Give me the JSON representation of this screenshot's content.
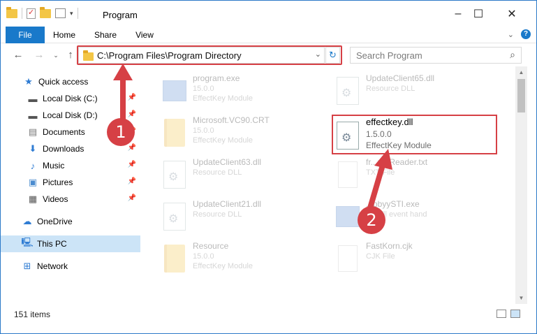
{
  "window": {
    "title": "Program"
  },
  "ribbon": {
    "tabs": [
      "File",
      "Home",
      "Share",
      "View"
    ]
  },
  "address": {
    "path": "C:\\Program Files\\Program Directory",
    "search_placeholder": "Search Program"
  },
  "nav": [
    {
      "label": "Quick access",
      "icon": "star-icon",
      "pinned": false
    },
    {
      "label": "Local Disk (C:)",
      "icon": "drive-icon",
      "pinned": true
    },
    {
      "label": "Local Disk (D:)",
      "icon": "drive-icon",
      "pinned": true
    },
    {
      "label": "Documents",
      "icon": "documents-icon",
      "pinned": true
    },
    {
      "label": "Downloads",
      "icon": "download-icon",
      "pinned": true
    },
    {
      "label": "Music",
      "icon": "music-icon",
      "pinned": true
    },
    {
      "label": "Pictures",
      "icon": "pictures-icon",
      "pinned": true
    },
    {
      "label": "Videos",
      "icon": "videos-icon",
      "pinned": true
    },
    {
      "label": "OneDrive",
      "icon": "cloud-icon",
      "pinned": false
    },
    {
      "label": "This PC",
      "icon": "computer-icon",
      "pinned": false,
      "selected": true
    },
    {
      "label": "Network",
      "icon": "network-icon",
      "pinned": false
    }
  ],
  "files": [
    {
      "name": "program.exe",
      "line2": "15.0.0",
      "line3": "EffectKey Module",
      "icon": "exe-icon"
    },
    {
      "name": "UpdateClient65.dll",
      "line2": "Resource DLL",
      "line3": "",
      "icon": "dll-icon"
    },
    {
      "name": "Microsoft.VC90.CRT",
      "line2": "15.0.0",
      "line3": "EffectKey Module",
      "icon": "folder-icon"
    },
    {
      "name": "effectkey.dll",
      "line2": "1.5.0.0",
      "line3": "EffectKey Module",
      "icon": "dll-icon"
    },
    {
      "name": "UpdateClient63.dll",
      "line2": "Resource DLL",
      "line3": "",
      "icon": "dll-icon"
    },
    {
      "name": "fr...meReader.txt",
      "line2": "TXT File",
      "line3": "",
      "icon": "text-file-icon"
    },
    {
      "name": "UpdateClient21.dll",
      "line2": "Resource DLL",
      "line3": "",
      "icon": "dll-icon"
    },
    {
      "name": "...bbyySTI.exe",
      "line2": "...F dll event hand",
      "line3": "",
      "icon": "exe-icon"
    },
    {
      "name": "Resource",
      "line2": "15.0.0",
      "line3": "EffectKey Module",
      "icon": "folder-icon"
    },
    {
      "name": "FastKorn.cjk",
      "line2": "CJK File",
      "line3": "",
      "icon": "file-icon"
    }
  ],
  "status": {
    "item_count": "151 items"
  },
  "annotations": {
    "step1": "1",
    "step2": "2"
  },
  "colors": {
    "accent": "#1979ca",
    "highlight": "#d64045"
  }
}
